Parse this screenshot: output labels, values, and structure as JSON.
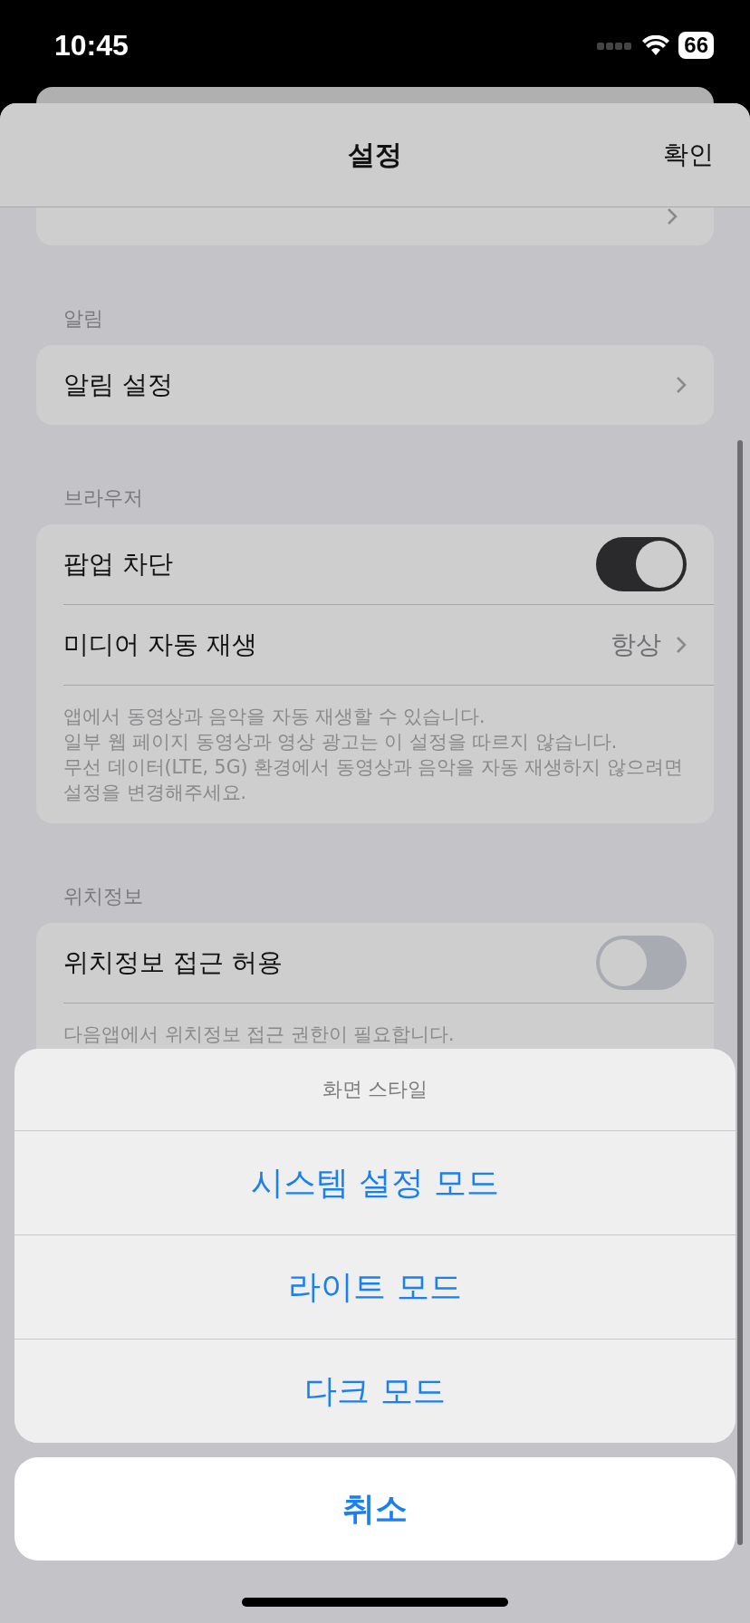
{
  "status_bar": {
    "time": "10:45",
    "battery": "66"
  },
  "header": {
    "title": "설정",
    "confirm": "확인"
  },
  "sections": [
    {
      "header": "알림",
      "rows": [
        {
          "kind": "link",
          "label": "알림 설정"
        }
      ]
    },
    {
      "header": "브라우저",
      "rows": [
        {
          "kind": "toggle",
          "label": "팝업 차단",
          "on": true
        },
        {
          "kind": "link",
          "label": "미디어 자동 재생",
          "value": "항상"
        }
      ],
      "footer": [
        "앱에서 동영상과 음악을 자동 재생할 수 있습니다.",
        "일부 웹 페이지 동영상과 영상 광고는 이 설정을 따르지 않습니다.",
        "무선 데이터(LTE, 5G) 환경에서 동영상과 음악을 자동 재생하지 않으려면 설정을 변경해주세요."
      ]
    },
    {
      "header": "위치정보",
      "rows": [
        {
          "kind": "toggle",
          "label": "위치정보 접근 허용",
          "on": false
        }
      ],
      "footer": [
        "다음앱에서 위치정보 접근 권한이 필요합니다."
      ]
    }
  ],
  "action_sheet": {
    "title": "화면 스타일",
    "options": [
      "시스템 설정 모드",
      "라이트 모드",
      "다크 모드"
    ],
    "cancel": "취소"
  }
}
